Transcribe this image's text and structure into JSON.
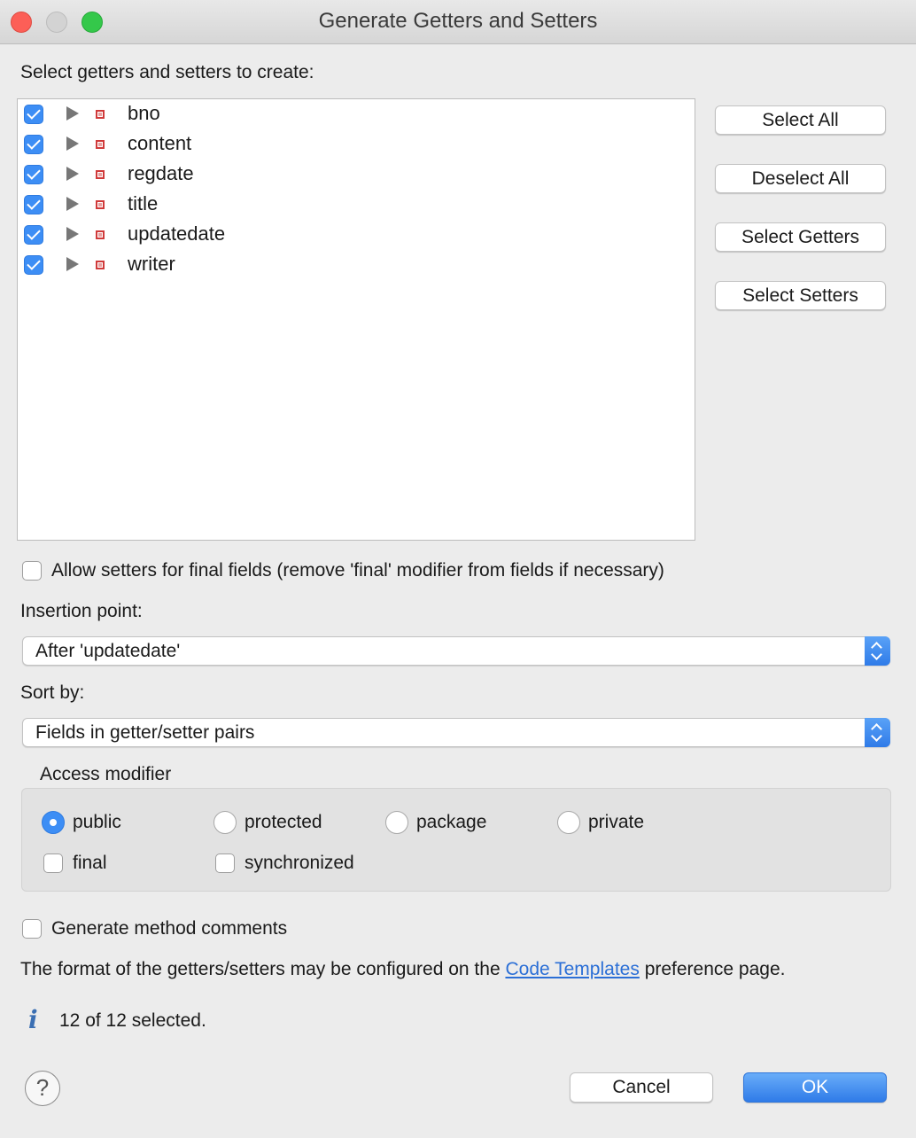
{
  "window": {
    "title": "Generate Getters and Setters"
  },
  "list": {
    "heading": "Select getters and setters to create:",
    "fields": [
      {
        "name": "bno",
        "checked": true
      },
      {
        "name": "content",
        "checked": true
      },
      {
        "name": "regdate",
        "checked": true
      },
      {
        "name": "title",
        "checked": true
      },
      {
        "name": "updatedate",
        "checked": true
      },
      {
        "name": "writer",
        "checked": true
      }
    ]
  },
  "side_buttons": {
    "select_all": "Select All",
    "deselect_all": "Deselect All",
    "select_getters": "Select Getters",
    "select_setters": "Select Setters"
  },
  "options": {
    "allow_final_setters": "Allow setters for final fields (remove 'final' modifier from fields if necessary)",
    "generate_comments": "Generate method comments"
  },
  "insertion": {
    "label": "Insertion point:",
    "value": "After 'updatedate'"
  },
  "sort": {
    "label": "Sort by:",
    "value": "Fields in getter/setter pairs"
  },
  "access": {
    "label": "Access modifier",
    "public": "public",
    "protected": "protected",
    "package": "package",
    "private": "private",
    "selected": "public",
    "final": "final",
    "synchronized": "synchronized"
  },
  "footer": {
    "format_prefix": "The format of the getters/setters may be configured on the",
    "format_link": "Code Templates",
    "format_suffix": "preference page.",
    "status": "12 of 12 selected.",
    "cancel": "Cancel",
    "ok": "OK"
  },
  "colors": {
    "accent": "#3d8ef5",
    "link": "#2b6fd6",
    "field_icon": "#d03a3a"
  }
}
